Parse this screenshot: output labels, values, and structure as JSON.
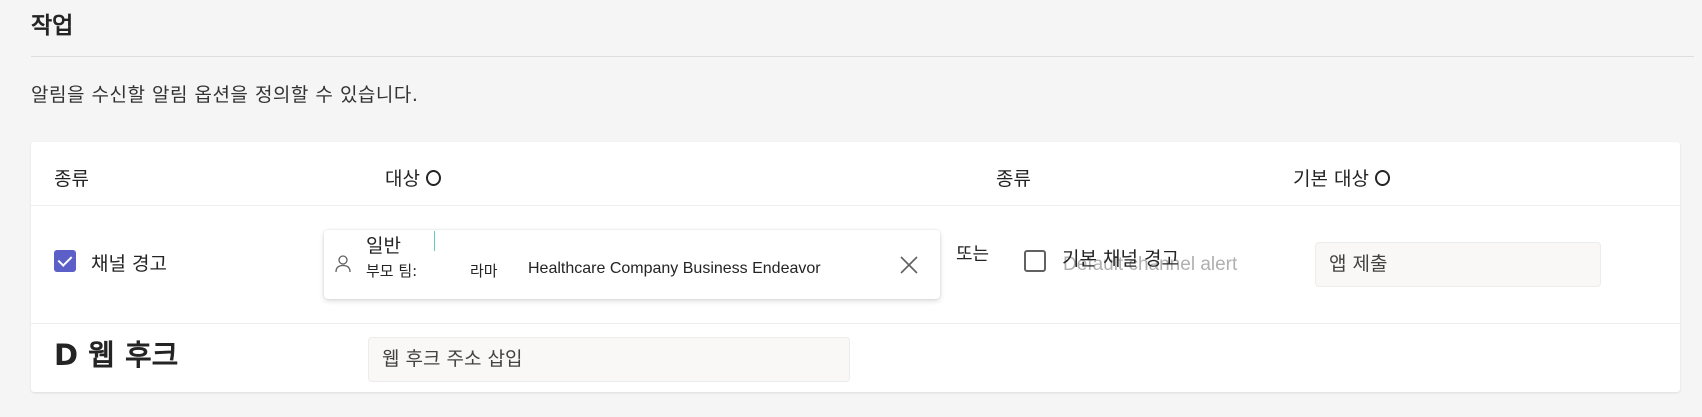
{
  "section": {
    "title": "작업",
    "description": "알림을 수신할 알림 옵션을 정의할 수 있습니다."
  },
  "table": {
    "headers": {
      "type1": "종류",
      "target": "대상",
      "type2": "종류",
      "default_target": "기본 대상"
    },
    "row1": {
      "checkbox_label": "채널 경고",
      "checked": true,
      "picker": {
        "name": "일반",
        "sub_label": "부모 팀:",
        "sub_value": "라마",
        "team": "Healthcare Company Business Endeavor"
      },
      "or_text": "또는",
      "default_checkbox_label": "기본 채널 경고",
      "default_checked": false,
      "overlap_text": "Default channel alert",
      "default_target_value": "앱 제출"
    },
    "row2": {
      "label": "D 웹 후크",
      "input_placeholder": "웹 후크 주소 삽입"
    }
  },
  "colors": {
    "accent": "#5b5fc7",
    "background": "#f5f5f5",
    "card": "#ffffff"
  },
  "icons": [
    "checkbox-checked-icon",
    "person-icon",
    "close-icon",
    "info-circle-icon",
    "checkbox-empty-icon"
  ]
}
